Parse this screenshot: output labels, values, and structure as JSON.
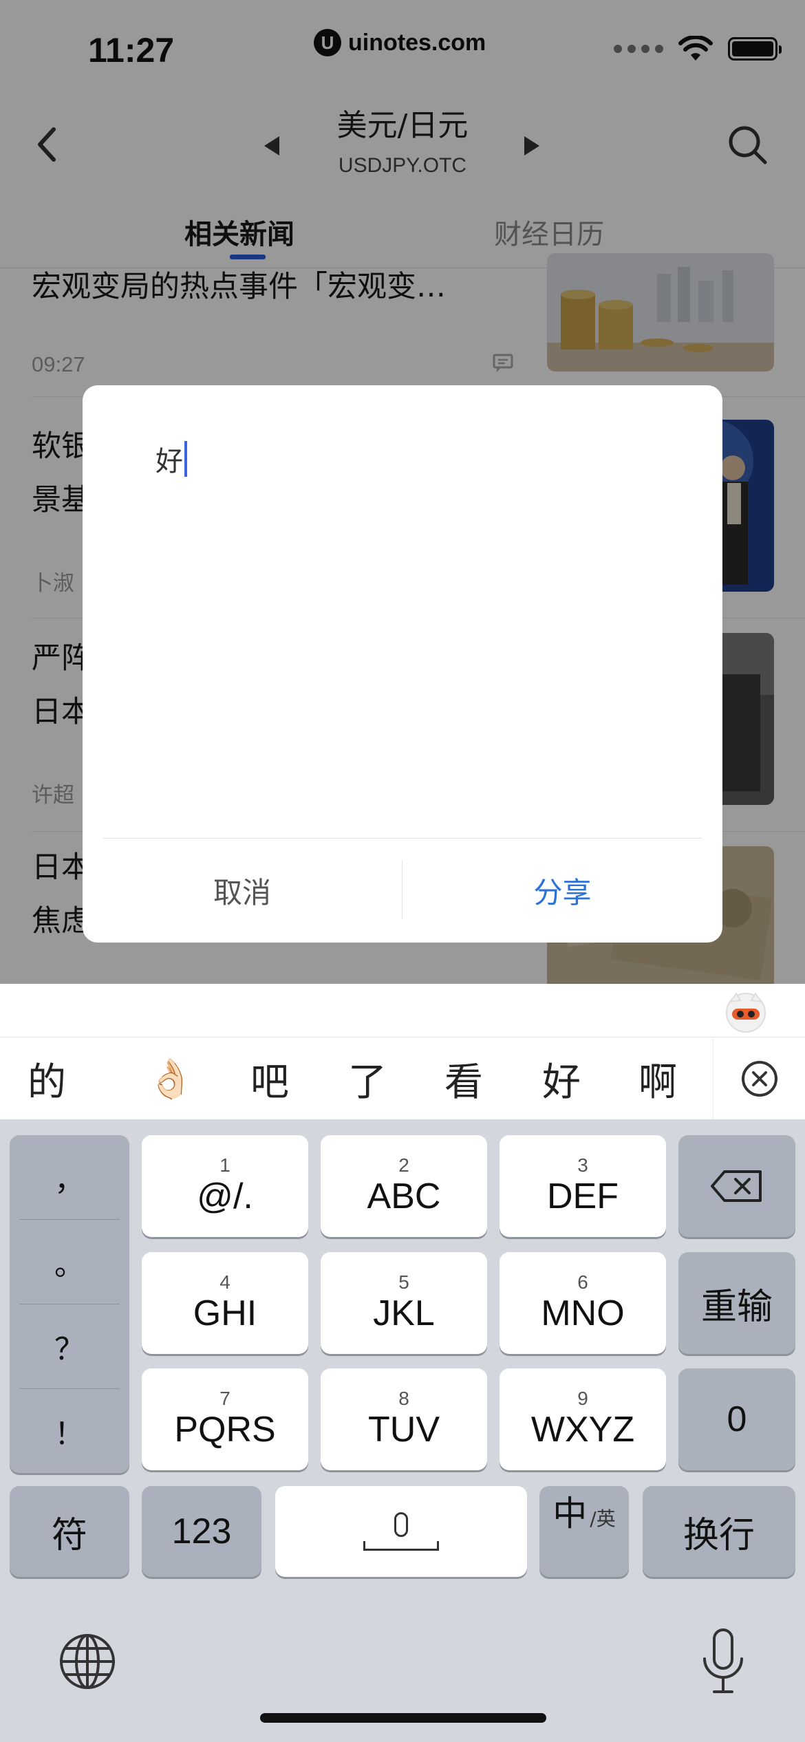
{
  "status_bar": {
    "time": "11:27",
    "url": "uinotes.com",
    "url_logo": "U"
  },
  "nav": {
    "pair_title": "美元/日元",
    "pair_code": "USDJPY.OTC"
  },
  "tabs": [
    {
      "label": "相关新闻",
      "active": true
    },
    {
      "label": "财经日历",
      "active": false
    }
  ],
  "news": [
    {
      "title": "宏观变局的热点事件「宏观变…",
      "meta": "09:27"
    },
    {
      "title_lines": [
        "软银",
        "景基"
      ],
      "meta": "卜淑"
    },
    {
      "title_lines": [
        "严阵",
        "日本"
      ],
      "meta": "许超"
    },
    {
      "title_lines": [
        "日本",
        "焦虑"
      ]
    }
  ],
  "dialog": {
    "input_value": "好",
    "cancel_label": "取消",
    "share_label": "分享"
  },
  "candidates": [
    "的",
    "👌🏻",
    "吧",
    "了",
    "看",
    "好",
    "啊"
  ],
  "keyboard": {
    "punctuation": [
      "，",
      "。",
      "？",
      "！"
    ],
    "rows": [
      [
        {
          "num": "1",
          "label": "@/."
        },
        {
          "num": "2",
          "label": "ABC"
        },
        {
          "num": "3",
          "label": "DEF"
        }
      ],
      [
        {
          "num": "4",
          "label": "GHI"
        },
        {
          "num": "5",
          "label": "JKL"
        },
        {
          "num": "6",
          "label": "MNO"
        }
      ],
      [
        {
          "num": "7",
          "label": "PQRS"
        },
        {
          "num": "8",
          "label": "TUV"
        },
        {
          "num": "9",
          "label": "WXYZ"
        }
      ]
    ],
    "reenter_label": "重输",
    "zero_label": "0",
    "symbols_label": "符",
    "numbers_label": "123",
    "lang_main": "中",
    "lang_sub": "/英",
    "newline_label": "换行"
  },
  "colors": {
    "accent": "#2b72d8",
    "tab_indicator": "#2a5bd7",
    "caret": "#3b62e0",
    "keyboard_bg": "#d3d6dd"
  }
}
